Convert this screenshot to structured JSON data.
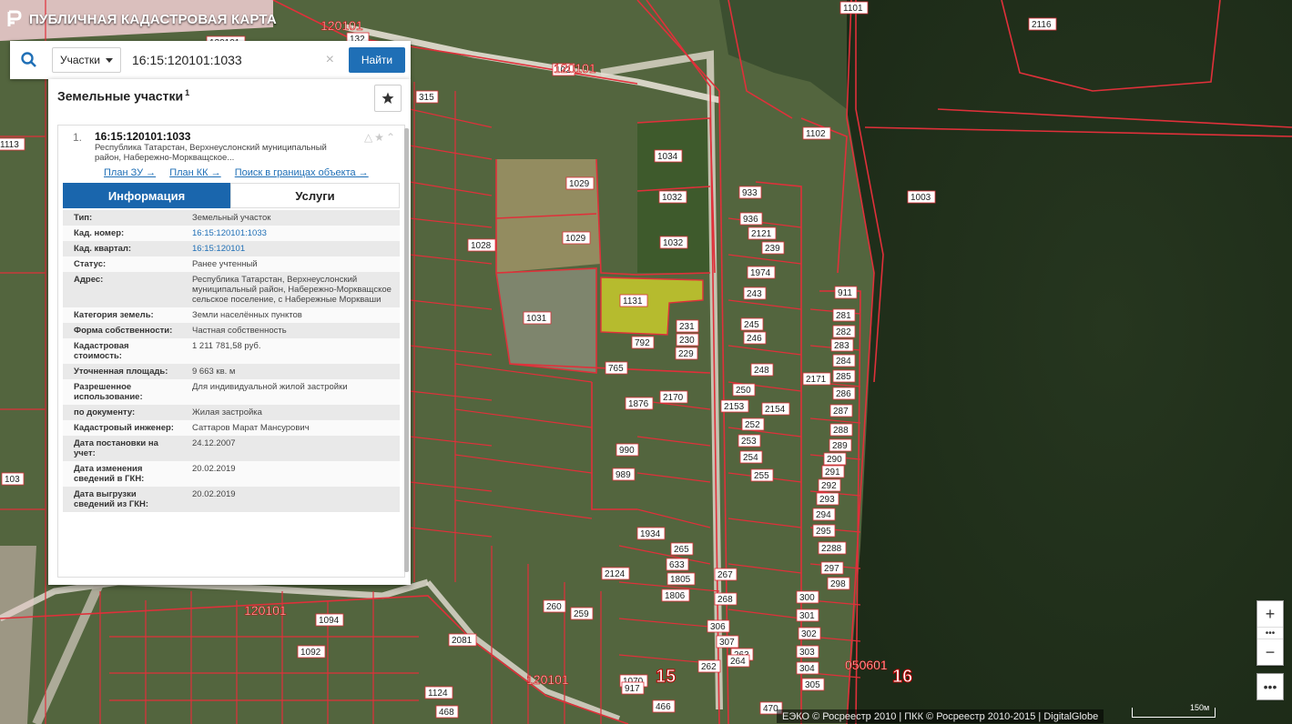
{
  "app": {
    "title": "ПУБЛИЧНАЯ КАДАСТРОВАЯ КАРТА"
  },
  "search": {
    "type_label": "Участки",
    "query": "16:15:120101:1033",
    "clear": "×",
    "find_label": "Найти"
  },
  "panel": {
    "title": "Земельные участки",
    "count": "1",
    "result": {
      "num": "1.",
      "cad_number": "16:15:120101:1033",
      "address_short": "Республика Татарстан, Верхнеуслонский муниципальный район, Набережно-Моркващское...",
      "links": [
        "План ЗУ →",
        "План КК →",
        "Поиск в границах объекта →"
      ],
      "tabs": [
        "Информация",
        "Услуги"
      ],
      "info": [
        {
          "k": "Тип:",
          "v": "Земельный участок"
        },
        {
          "k": "Кад. номер:",
          "v": "16:15:120101:1033"
        },
        {
          "k": "Кад. квартал:",
          "v": "16:15:120101"
        },
        {
          "k": "Статус:",
          "v": "Ранее учтенный"
        },
        {
          "k": "Адрес:",
          "v": "Республика Татарстан, Верхнеуслонский муниципальный район, Набережно-Моркващское сельское поселение, с Набережные Моркваши"
        },
        {
          "k": "Категория земель:",
          "v": "Земли населённых пунктов"
        },
        {
          "k": "Форма собственности:",
          "v": "Частная собственность"
        },
        {
          "k": "Кадастровая стоимость:",
          "v": "1 211 781,58 руб."
        },
        {
          "k": "Уточненная площадь:",
          "v": "9 663 кв. м"
        },
        {
          "k": "Разрешенное использование:",
          "v": "Для индивидуальной жилой застройки"
        },
        {
          "k": "по документу:",
          "v": "Жилая застройка"
        },
        {
          "k": "Кадастровый инженер:",
          "v": "Саттаров Марат Мансурович"
        },
        {
          "k": "Дата постановки на учет:",
          "v": "24.12.2007"
        },
        {
          "k": "Дата изменения сведений в ГКН:",
          "v": "20.02.2019"
        },
        {
          "k": "Дата выгрузки сведений из ГКН:",
          "v": "20.02.2019"
        }
      ]
    }
  },
  "map": {
    "highlight_label": "1033",
    "parcel_labels": [
      "120101",
      "1029",
      "1028",
      "1032",
      "1034",
      "1031",
      "1032",
      "1029",
      "792",
      "765",
      "1876",
      "2170",
      "990",
      "989",
      "1934",
      "231",
      "230",
      "229",
      "243",
      "245",
      "246",
      "248",
      "250",
      "252",
      "253",
      "254",
      "255",
      "1974",
      "2121",
      "2153",
      "2154",
      "2171",
      "933",
      "936",
      "239",
      "911",
      "281",
      "282",
      "283",
      "284",
      "285",
      "286",
      "287",
      "288",
      "289",
      "290",
      "291",
      "292",
      "293",
      "294",
      "295",
      "2288",
      "297",
      "298",
      "300",
      "301",
      "302",
      "303",
      "304",
      "305",
      "306",
      "307",
      "262",
      "263",
      "264",
      "265",
      "633",
      "1805",
      "1806",
      "267",
      "268",
      "259",
      "260",
      "2124",
      "2081",
      "1070",
      "917",
      "1092",
      "1094",
      "470",
      "466",
      "468",
      "1124",
      "315",
      "2116",
      "1101",
      "1102",
      "1003",
      "1113",
      "103",
      "132",
      "102",
      "1131",
      "1129",
      "356",
      "269",
      "120101",
      "120101",
      "1033"
    ],
    "quarter_labels": [
      "120101",
      "120101",
      "120101",
      "120101",
      "050601"
    ],
    "big_labels": [
      "15",
      "16"
    ]
  },
  "controls": {
    "zoom_in": "+",
    "zoom_mid": "•••",
    "zoom_out": "−",
    "more": "•••"
  },
  "footer": {
    "attribution": "ЕЭКО © Росреестр 2010 | ПКК © Росреестр 2010-2015 | DigitalGlobe",
    "scale": "150м"
  },
  "colors": {
    "accent": "#1f6fb6",
    "parcel_line": "#e0303a",
    "highlight": "#d8d62a"
  }
}
